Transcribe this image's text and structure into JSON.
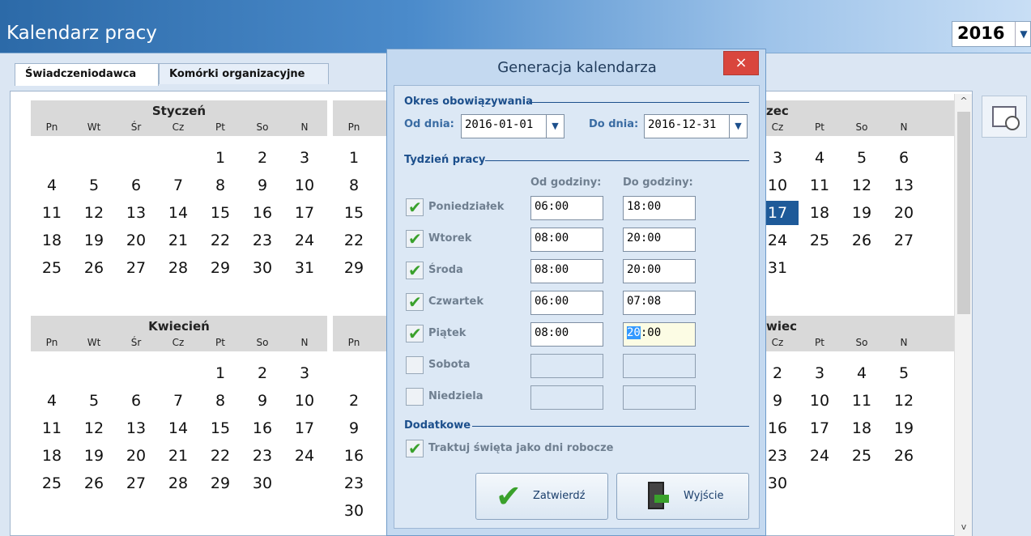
{
  "app": {
    "title": "Kalendarz pracy",
    "year": "2016"
  },
  "tabs": [
    "Świadczeniodawca",
    "Komórki organizacyjne"
  ],
  "weekdays": [
    "Pn",
    "Wt",
    "Śr",
    "Cz",
    "Pt",
    "So",
    "N"
  ],
  "months": {
    "jan": {
      "name": "Styczeń"
    },
    "apr": {
      "name": "Kwiecień"
    },
    "mar_partial": {
      "name": "zec"
    },
    "jun_partial": {
      "name": "wiec"
    }
  },
  "dialog": {
    "title": "Generacja kalendarza",
    "close": "×",
    "period": {
      "title": "Okres obowiązywania",
      "from_label": "Od dnia:",
      "from_value": "2016-01-01",
      "to_label": "Do dnia:",
      "to_value": "2016-12-31"
    },
    "week": {
      "title": "Tydzień pracy",
      "from_head": "Od godziny:",
      "to_head": "Do godziny:",
      "days": [
        {
          "name": "Poniedziałek",
          "checked": true,
          "from": "06:00",
          "to": "18:00"
        },
        {
          "name": "Wtorek",
          "checked": true,
          "from": "08:00",
          "to": "20:00"
        },
        {
          "name": "Środa",
          "checked": true,
          "from": "08:00",
          "to": "20:00"
        },
        {
          "name": "Czwartek",
          "checked": true,
          "from": "06:00",
          "to": "07:08"
        },
        {
          "name": "Piątek",
          "checked": true,
          "from": "08:00",
          "to_sel": "20",
          "to_rest": ":00"
        },
        {
          "name": "Sobota",
          "checked": false,
          "from": "",
          "to": ""
        },
        {
          "name": "Niedziela",
          "checked": false,
          "from": "",
          "to": ""
        }
      ]
    },
    "extra": {
      "title": "Dodatkowe",
      "holidays_label": "Traktuj święta jako dni robocze"
    },
    "buttons": {
      "confirm": "Zatwierdź",
      "exit": "Wyjście"
    }
  },
  "icons": {
    "check": "✔",
    "dropdown": "▼",
    "scroll_up": "^",
    "scroll_down": "v"
  },
  "colors": {
    "accent": "#1e5a99",
    "check": "#3aa12c",
    "close": "#d9463d"
  }
}
